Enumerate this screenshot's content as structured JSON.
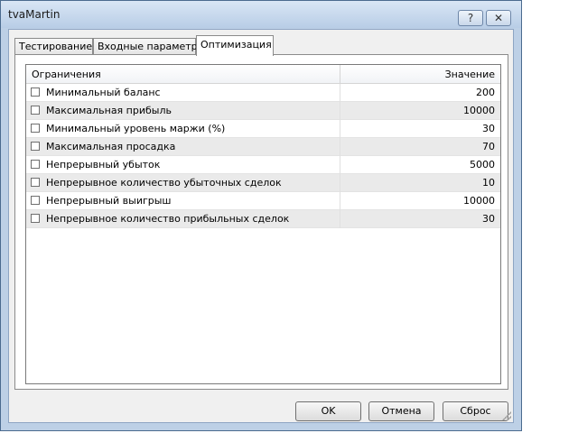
{
  "window": {
    "title": "tvaMartin",
    "help_glyph": "?",
    "close_glyph": "✕"
  },
  "tabs": [
    {
      "label": "Тестирование"
    },
    {
      "label": "Входные параметры"
    },
    {
      "label": "Оптимизация",
      "active": true
    }
  ],
  "grid": {
    "header": {
      "name": "Ограничения",
      "value": "Значение"
    },
    "rows": [
      {
        "label": "Минимальный баланс",
        "value": "200",
        "checked": false
      },
      {
        "label": "Максимальная прибыль",
        "value": "10000",
        "checked": false
      },
      {
        "label": "Минимальный уровень маржи (%)",
        "value": "30",
        "checked": false
      },
      {
        "label": "Максимальная просадка",
        "value": "70",
        "checked": false
      },
      {
        "label": "Непрерывный убыток",
        "value": "5000",
        "checked": false
      },
      {
        "label": "Непрерывное количество убыточных сделок",
        "value": "10",
        "checked": false
      },
      {
        "label": "Непрерывный выигрыш",
        "value": "10000",
        "checked": false
      },
      {
        "label": "Непрерывное количество прибыльных сделок",
        "value": "30",
        "checked": false
      }
    ]
  },
  "buttons": {
    "ok": "OK",
    "cancel": "Отмена",
    "reset": "Сброс"
  },
  "colors": {
    "window_frame": "#bdd0e6",
    "alt_row": "#eaeaea"
  }
}
